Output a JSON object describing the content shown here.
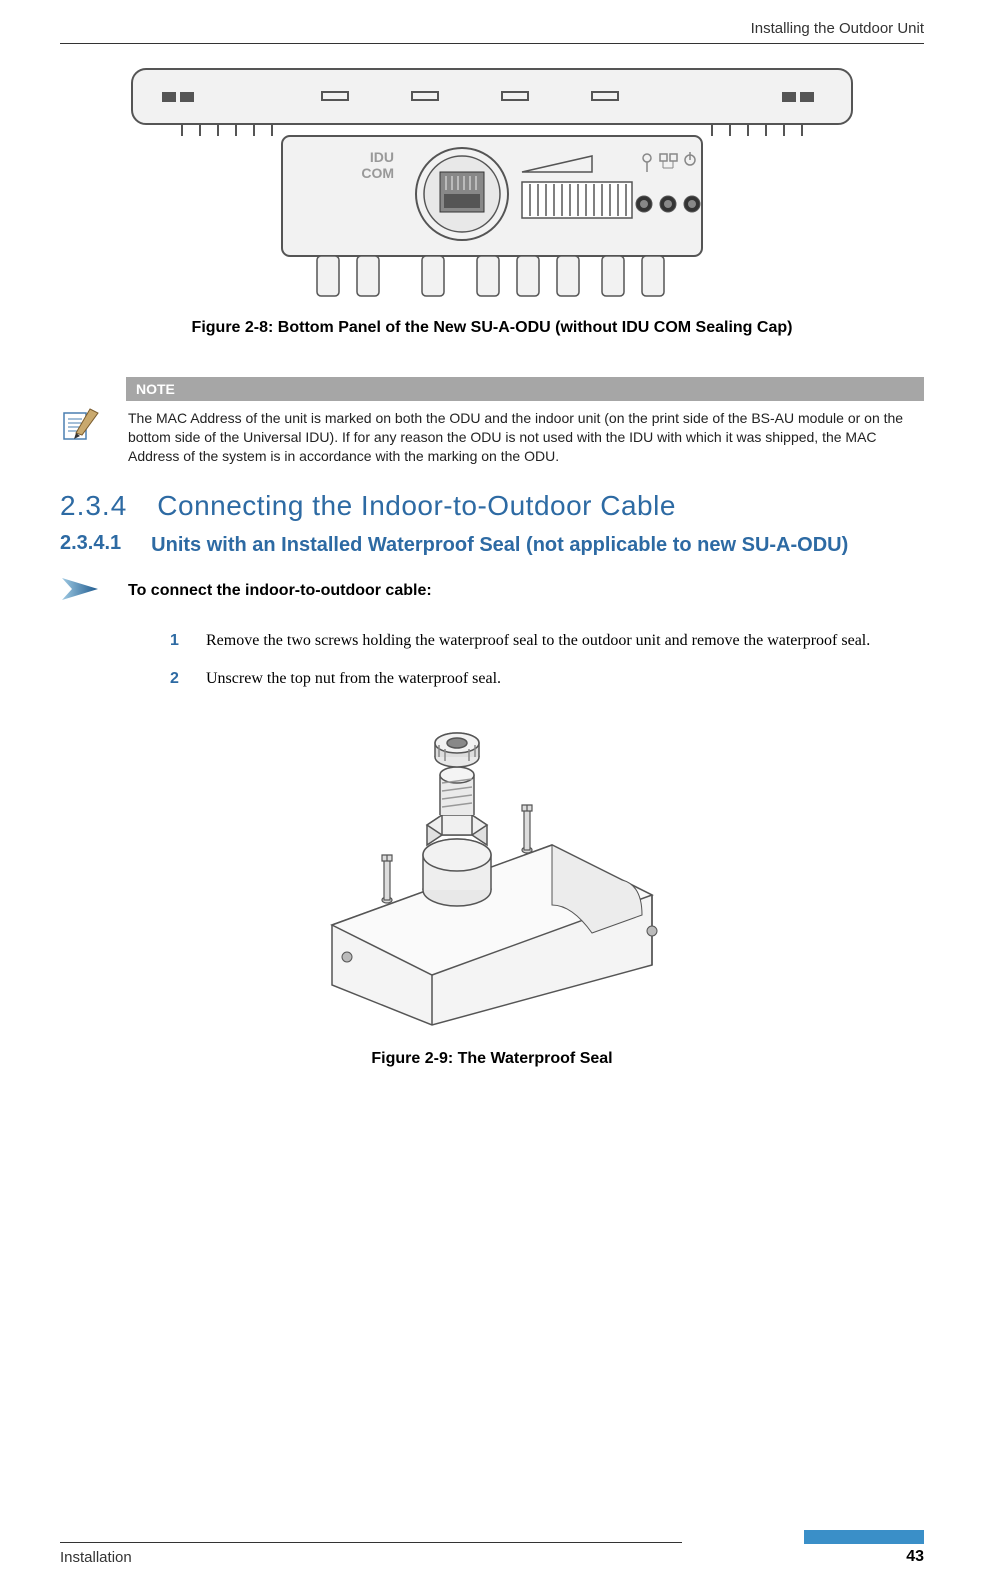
{
  "header": {
    "chapter_title": "Installing the Outdoor Unit"
  },
  "figure1": {
    "label_line1": "IDU",
    "label_line2": "COM",
    "caption": "Figure 2-8: Bottom Panel of the New SU-A-ODU (without IDU COM Sealing Cap)"
  },
  "note": {
    "header": "NOTE",
    "text": "The MAC Address of the unit is marked on both the ODU and the indoor unit (on the print side of the BS-AU module or on the bottom side of the Universal IDU). If for any reason the ODU is not used with the IDU with which it was shipped, the MAC Address of the system is in accordance with the marking on the ODU."
  },
  "h2": {
    "num": "2.3.4",
    "text": "Connecting the Indoor-to-Outdoor Cable"
  },
  "h3": {
    "num": "2.3.4.1",
    "text": "Units with an Installed Waterproof Seal (not applicable to new SU-A-ODU)"
  },
  "procedure": {
    "title": "To connect the indoor-to-outdoor cable:"
  },
  "steps": [
    {
      "num": "1",
      "text": "Remove the two screws holding the waterproof seal to the outdoor unit and remove the waterproof seal."
    },
    {
      "num": "2",
      "text": "Unscrew the top nut from the waterproof seal."
    }
  ],
  "figure2": {
    "caption": "Figure 2-9: The Waterproof Seal"
  },
  "footer": {
    "left": "Installation",
    "page": "43"
  }
}
